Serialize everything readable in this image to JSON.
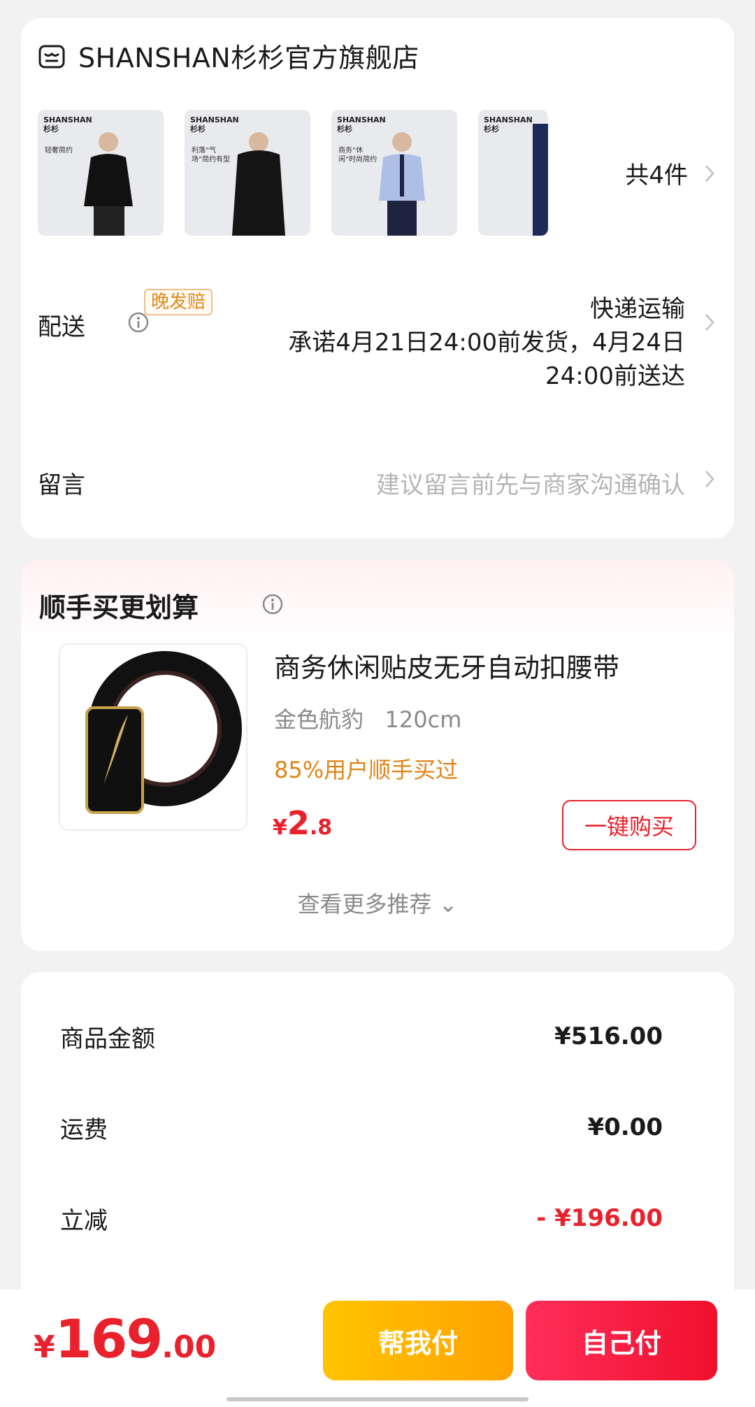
{
  "store": {
    "name": "SHANSHAN杉杉官方旗舰店",
    "icon": "store-icon",
    "products": [
      {
        "brand": "SHANSHAN\n杉杉",
        "tag": "轻奢简约"
      },
      {
        "brand": "SHANSHAN\n杉杉",
        "tag": "利落“气场”简约有型"
      },
      {
        "brand": "SHANSHAN\n杉杉",
        "tag": "商务“休闲”时尚简约"
      },
      {
        "brand": "SHANSHAN\n杉杉",
        "tag": ""
      }
    ],
    "count_label": "共4件"
  },
  "delivery": {
    "label": "配送",
    "badge": "晚发赔",
    "method": "快递运输",
    "promise": "承诺4月21日24:00前发货，4月24日24:00前送达"
  },
  "note": {
    "label": "留言",
    "placeholder": "建议留言前先与商家沟通确认"
  },
  "recommendation": {
    "title": "顺手买更划算",
    "product_name": "商务休闲贴皮无牙自动扣腰带",
    "spec": "金色航豹   120cm",
    "social_proof": "85%用户顺手买过",
    "price_symbol": "¥",
    "price_int": "2",
    "price_dec": ".8",
    "buy_label": "一键购买",
    "more_label": "查看更多推荐 ⌄"
  },
  "summary": {
    "rows": [
      {
        "label": "商品金额",
        "value": "¥516.00"
      },
      {
        "label": "运费",
        "value": "¥0.00"
      },
      {
        "label": "立减",
        "value": "- ¥196.00"
      }
    ]
  },
  "footer": {
    "total_symbol": "¥",
    "total_int": "169",
    "total_dec": ".00",
    "help_pay_label": "帮我付",
    "self_pay_label": "自己付"
  },
  "colors": {
    "accent_red": "#e8212c",
    "accent_orange": "#e08416",
    "help_btn": "#ffb300",
    "self_btn": "#f51a3c"
  }
}
